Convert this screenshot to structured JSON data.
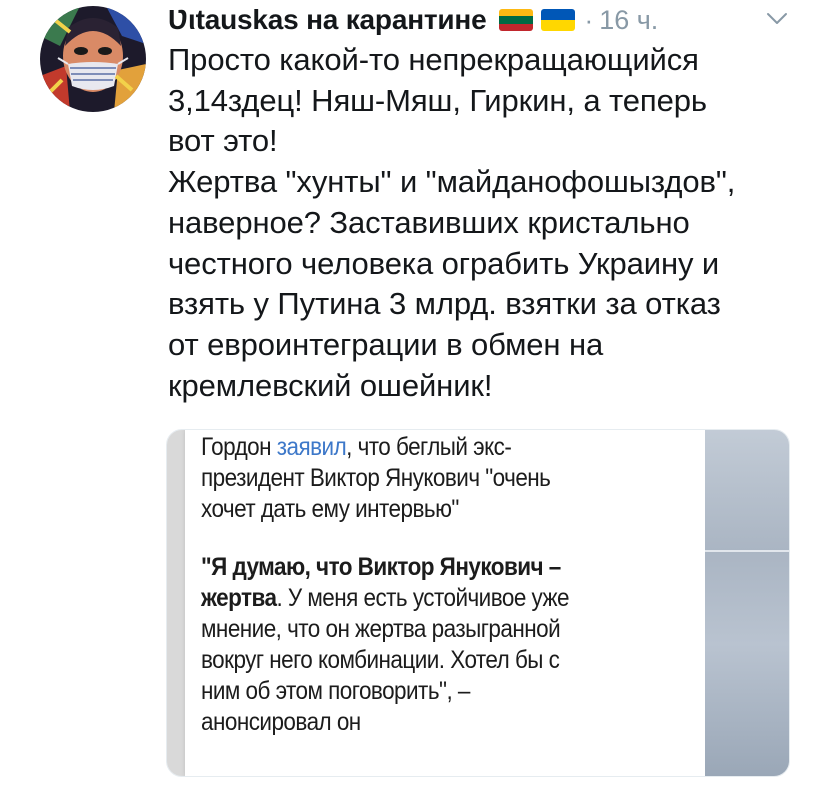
{
  "tweet": {
    "display_name": "Ʋιtauskas на карантине",
    "flags": [
      "flag-lithuania",
      "flag-ukraine"
    ],
    "separator": "·",
    "time": "16 ч.",
    "text": "Просто какой-то непрекращающийся\n3,14здец! Няш-Мяш, Гиркин, а теперь\nвот это!\nЖертва \"хунты\" и \"майданофошыздов\",\nнаверное? Заставивших кристально\nчестного человека ограбить Украину и\nвзять у Путина 3 млрд. взятки за отказ\nот евроинтеграции в обмен на\nкремлевский ошейник!"
  },
  "media": {
    "p1_a": "Гордон ",
    "p1_link": "заявил",
    "p1_b": ", что беглый экс-\nпрезидент Виктор Янукович \"очень\nхочет дать ему интервью\"",
    "p2_bold": "\"Я думаю, что Виктор Янукович –\nжертва",
    "p2_rest": ". У меня есть устойчивое уже\nмнение, что он жертва разыгранной\nвокруг него комбинации. Хотел бы с\nним об этом поговорить\", –\nанонсировал он"
  },
  "colors": {
    "text": "#14171a",
    "muted": "#8899a6",
    "link": "#3d78c9",
    "flag_lt_yellow": "#fdb913",
    "flag_lt_green": "#006a44",
    "flag_lt_red": "#c1272d",
    "flag_ua_blue": "#0057b7",
    "flag_ua_yellow": "#ffd700"
  }
}
